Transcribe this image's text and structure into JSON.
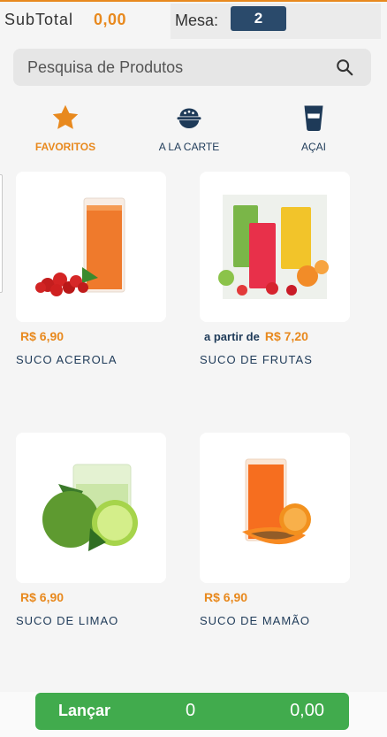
{
  "header": {
    "subtotal_label": "SubTotal",
    "subtotal_value": "0,00",
    "mesa_label": "Mesa:",
    "mesa_value": "2"
  },
  "search": {
    "placeholder": "Pesquisa de Produtos",
    "icon": "search-icon"
  },
  "categories": [
    {
      "label": "FAVORITOS",
      "icon": "star-icon",
      "active": true
    },
    {
      "label": "A LA CARTE",
      "icon": "bowl-icon",
      "active": false
    },
    {
      "label": "AÇAI",
      "icon": "cup-icon",
      "active": false
    }
  ],
  "products": [
    {
      "prefix": "",
      "price": "R$ 6,90",
      "name": "SUCO ACEROLA"
    },
    {
      "prefix": "a partir de",
      "price": "R$ 7,20",
      "name": "SUCO DE FRUTAS"
    },
    {
      "prefix": "",
      "price": "R$ 6,90",
      "name": "SUCO DE LIMAO"
    },
    {
      "prefix": "",
      "price": "R$ 6,90",
      "name": "SUCO DE MAMÃO"
    }
  ],
  "footer": {
    "label": "Lançar",
    "count": "0",
    "total": "0,00"
  },
  "colors": {
    "accent": "#e8891e",
    "navy": "#1e3a58",
    "button": "#41ab4d"
  }
}
